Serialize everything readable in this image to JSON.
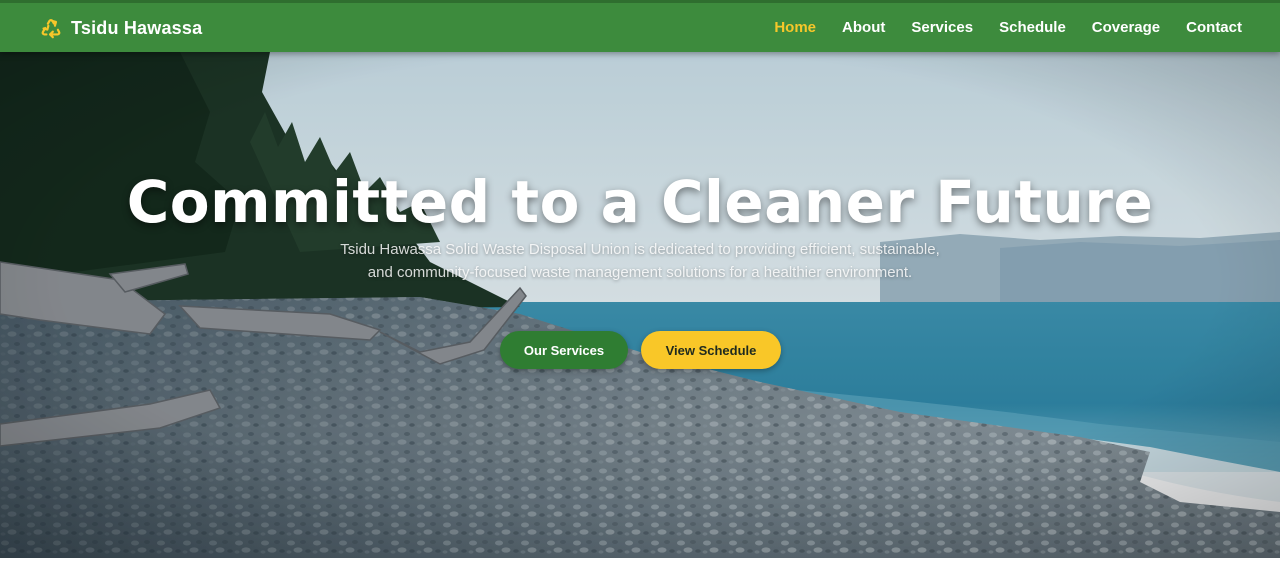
{
  "brand": {
    "name": "Tsidu Hawassa",
    "icon": "recycle-icon",
    "accent_color": "#f7c72a",
    "nav_color": "#3d8b3d"
  },
  "nav": {
    "items": [
      {
        "label": "Home",
        "active": true
      },
      {
        "label": "About",
        "active": false
      },
      {
        "label": "Services",
        "active": false
      },
      {
        "label": "Schedule",
        "active": false
      },
      {
        "label": "Coverage",
        "active": false
      },
      {
        "label": "Contact",
        "active": false
      }
    ]
  },
  "hero": {
    "title": "Committed to a Cleaner Future",
    "subtitle": "Tsidu Hawassa Solid Waste Disposal Union is dedicated to providing efficient, sustainable, and community-focused waste management solutions for a healthier environment.",
    "background": "pebble beach with driftwood, evergreen forest and calm ocean",
    "primary_button": {
      "label": "Our Services",
      "color": "#2f7d32"
    },
    "secondary_button": {
      "label": "View Schedule",
      "color": "#f9c728"
    }
  }
}
